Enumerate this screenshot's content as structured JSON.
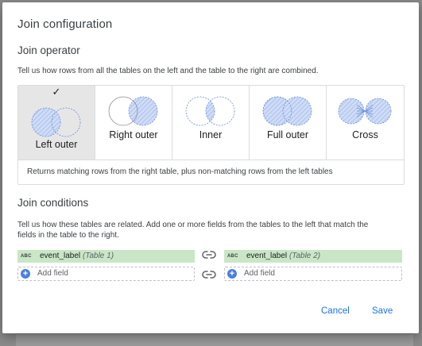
{
  "dialog": {
    "title": "Join configuration",
    "operator_section": {
      "title": "Join operator",
      "description": "Tell us how rows from all the tables on the left and the table to the right are combined.",
      "operators": [
        {
          "label": "Left outer",
          "icon": "left-outer-join-icon",
          "selected": true
        },
        {
          "label": "Right outer",
          "icon": "right-outer-join-icon",
          "selected": false
        },
        {
          "label": "Inner",
          "icon": "inner-join-icon",
          "selected": false
        },
        {
          "label": "Full outer",
          "icon": "full-outer-join-icon",
          "selected": false
        },
        {
          "label": "Cross",
          "icon": "cross-join-icon",
          "selected": false
        }
      ],
      "selected_mark": "✓",
      "selected_description": "Returns matching rows from the right table, plus non-matching rows from the left tables"
    },
    "conditions_section": {
      "title": "Join conditions",
      "description_line1": "Tell us how these tables are related. Add one or more fields from the tables to the left that match the",
      "description_line2": "fields in the table to the right.",
      "left_field": {
        "type": "ABC",
        "name": "event_label",
        "table": "(Table 1)"
      },
      "right_field": {
        "type": "ABC",
        "name": "event_label",
        "table": "(Table 2)"
      },
      "add_field_label": "Add field",
      "add_icon": "+"
    },
    "buttons": {
      "cancel": "Cancel",
      "save": "Save"
    }
  },
  "colors": {
    "accent": "#1a73e8",
    "venn_fill": "#cfdcf6",
    "venn_stroke": "#6b8fd9",
    "field_chip": "#c9e6c6",
    "selected_bg": "#e6e6e6"
  }
}
